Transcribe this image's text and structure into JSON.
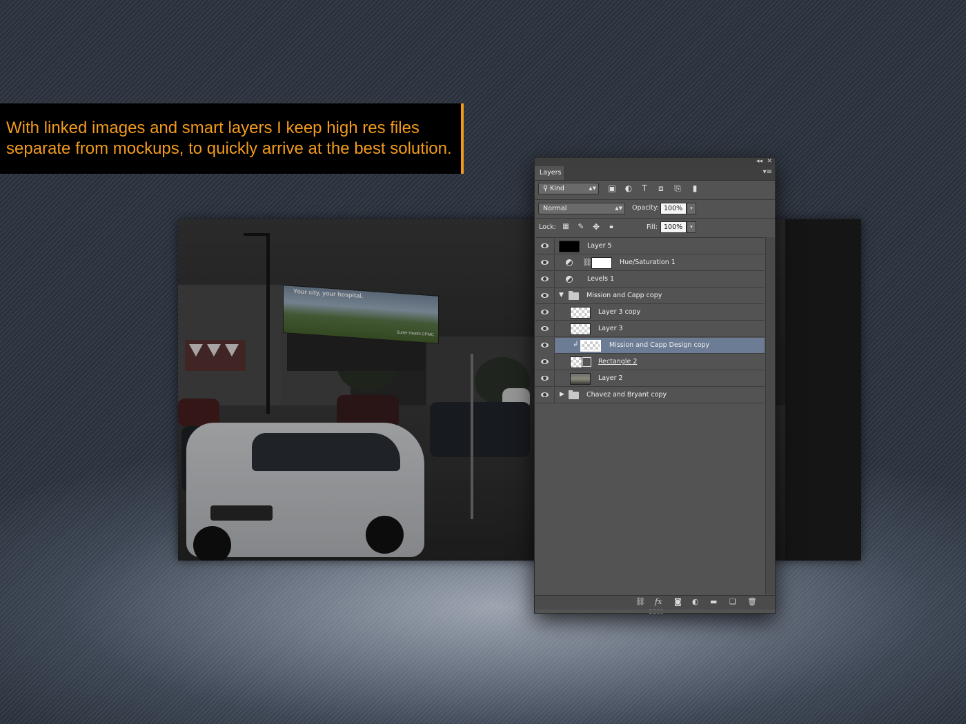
{
  "caption": {
    "line1": "With linked images and smart layers I keep high res files",
    "line2": "separate from mockups, to quickly arrive at the best solution.",
    "accent_color": "#f19a1b"
  },
  "billboard": {
    "headline": "Your city, your hospital.",
    "logo_text": "Sutter Health CPMC"
  },
  "layers_panel": {
    "tab_label": "Layers",
    "filter_kind": "Kind",
    "blend_mode": "Normal",
    "opacity_label": "Opacity:",
    "opacity_value": "100%",
    "lock_label": "Lock:",
    "fill_label": "Fill:",
    "fill_value": "100%",
    "filter_icons": [
      "image-filter-icon",
      "adjustment-filter-icon",
      "type-filter-icon",
      "shape-filter-icon",
      "smart-object-filter-icon",
      "filter-toggle-icon"
    ],
    "lock_icons": [
      "lock-transparent-icon",
      "lock-paint-icon",
      "lock-move-icon",
      "lock-all-icon"
    ],
    "bottom_icons": [
      "link-layers-icon",
      "fx-icon",
      "add-mask-icon",
      "new-adjustment-icon",
      "new-group-icon",
      "new-layer-icon",
      "delete-icon"
    ],
    "layers": [
      {
        "name": "Layer 5",
        "type": "pixel",
        "thumb": "black",
        "indent": 0
      },
      {
        "name": "Hue/Saturation 1",
        "type": "adjustment-mask",
        "indent": 0
      },
      {
        "name": "Levels 1",
        "type": "adjustment",
        "indent": 0
      },
      {
        "name": "Mission and Capp copy",
        "type": "group-open",
        "indent": 0
      },
      {
        "name": "Layer 3 copy",
        "type": "pixel",
        "thumb": "checker",
        "indent": 1
      },
      {
        "name": "Layer 3",
        "type": "pixel",
        "thumb": "checker",
        "indent": 1
      },
      {
        "name": "Mission and Capp Design copy",
        "type": "smart-object",
        "indent": 1,
        "selected": true
      },
      {
        "name": "Rectangle 2",
        "type": "shape",
        "indent": 1
      },
      {
        "name": "Layer 2",
        "type": "pixel",
        "thumb": "photo",
        "indent": 1
      },
      {
        "name": "Chavez and Bryant copy",
        "type": "group-closed",
        "indent": 0
      }
    ],
    "selection_color": "#6d7c95"
  }
}
